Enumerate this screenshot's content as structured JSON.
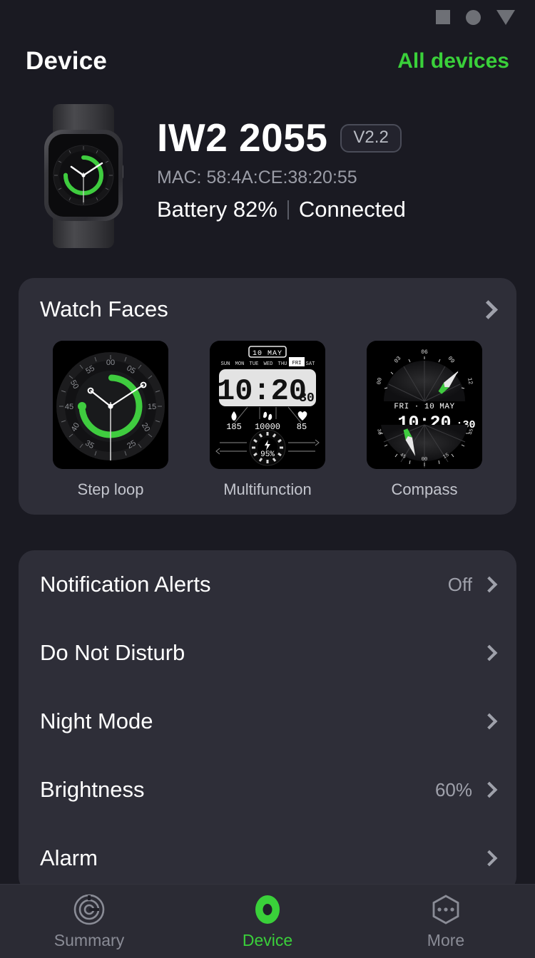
{
  "theme": {
    "background": "#1a1a22",
    "card": "#2e2e38",
    "accent_green": "#3ad03a",
    "text_primary": "#ffffff",
    "text_secondary": "#9fa1ab"
  },
  "statusbar": {
    "icons": [
      "square-icon",
      "circle-icon",
      "triangle-down-icon"
    ]
  },
  "topbar": {
    "title": "Device",
    "all_devices_label": "All devices"
  },
  "device": {
    "name": "IW2 2055",
    "version_badge": "V2.2",
    "mac": "MAC: 58:4A:CE:38:20:55",
    "battery": "Battery 82%",
    "connection": "Connected"
  },
  "watch_faces": {
    "title": "Watch Faces",
    "items": [
      {
        "label": "Step loop",
        "type": "analog-step-loop",
        "ticks": [
          "00",
          "05",
          "15",
          "20",
          "25",
          "35",
          "40",
          "45",
          "50",
          "55"
        ],
        "ring_progress_pct": 72
      },
      {
        "label": "Multifunction",
        "type": "digital-multifunction",
        "date": "10 MAY",
        "weekdays": [
          "SUN",
          "MON",
          "TUE",
          "WED",
          "THU",
          "FRI",
          "SAT"
        ],
        "active_weekday": "FRI",
        "time": "10:20",
        "seconds": "30",
        "stats": [
          {
            "icon": "flame-icon",
            "value": "185"
          },
          {
            "icon": "footsteps-icon",
            "value": "10000"
          },
          {
            "icon": "heart-icon",
            "value": "85"
          }
        ],
        "battery": "95%"
      },
      {
        "label": "Compass",
        "type": "compass",
        "date": "FRI · 10 MAY",
        "time": "10:20:30",
        "hour_ticks": [
          "00",
          "03",
          "06",
          "09",
          "12"
        ],
        "minute_ticks": [
          "00",
          "15",
          "30",
          "45"
        ]
      }
    ]
  },
  "settings": {
    "rows": [
      {
        "label": "Notification Alerts",
        "value": "Off"
      },
      {
        "label": "Do Not Disturb",
        "value": ""
      },
      {
        "label": "Night Mode",
        "value": ""
      },
      {
        "label": "Brightness",
        "value": "60%"
      },
      {
        "label": "Alarm",
        "value": ""
      }
    ]
  },
  "bottomnav": {
    "items": [
      {
        "label": "Summary",
        "icon": "target-rings-icon",
        "active": false
      },
      {
        "label": "Device",
        "icon": "device-ring-icon",
        "active": true
      },
      {
        "label": "More",
        "icon": "hexagon-dots-icon",
        "active": false
      }
    ]
  }
}
